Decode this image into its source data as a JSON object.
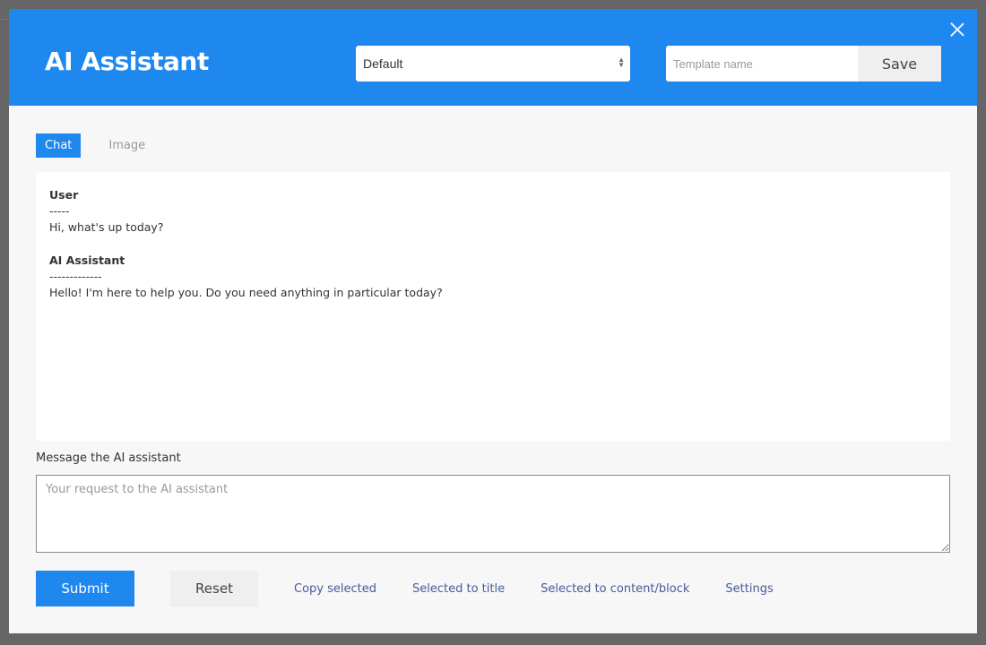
{
  "header": {
    "title": "AI Assistant",
    "template_select": {
      "selected": "Default"
    },
    "template_name": {
      "value": "",
      "placeholder": "Template name"
    },
    "save_label": "Save",
    "close_icon": "close-icon"
  },
  "tabs": [
    {
      "label": "Chat",
      "active": true
    },
    {
      "label": "Image",
      "active": false
    }
  ],
  "conversation": [
    {
      "role": "User",
      "separator": "-----",
      "text": "Hi, what's up today?"
    },
    {
      "role": "AI Assistant",
      "separator": "-------------",
      "text": "Hello! I'm here to help you. Do you need anything in particular today?"
    }
  ],
  "message": {
    "label": "Message the AI assistant",
    "value": "",
    "placeholder": "Your request to the AI assistant"
  },
  "actions": {
    "submit": "Submit",
    "reset": "Reset",
    "links": [
      "Copy selected",
      "Selected to title",
      "Selected to content/block",
      "Settings"
    ]
  },
  "colors": {
    "accent": "#1e88ef",
    "link": "#4a5a9a",
    "backdrop": "#666666"
  }
}
